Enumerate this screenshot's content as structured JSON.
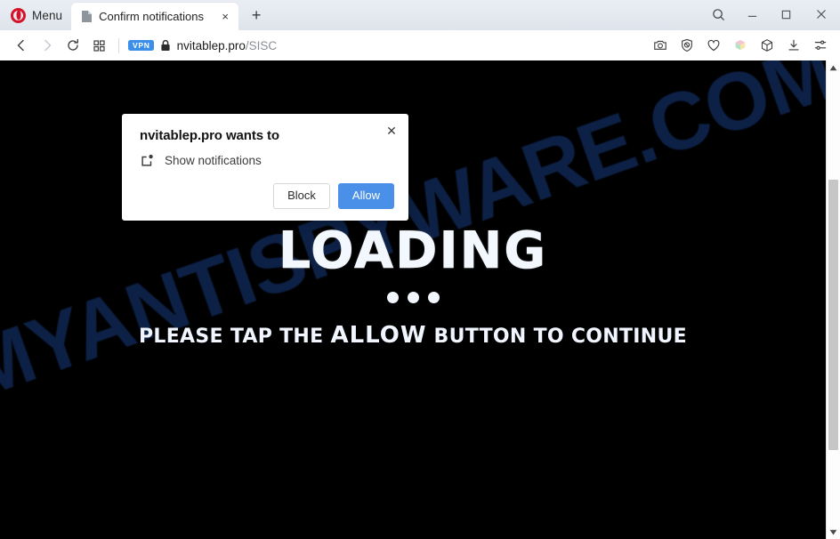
{
  "browser": {
    "menu_label": "Menu",
    "tab": {
      "title": "Confirm notifications",
      "favicon": "page-icon",
      "close": "×"
    },
    "new_tab": "+",
    "window_controls": {
      "search": "search-icon",
      "minimize": "minimize-icon",
      "maximize": "maximize-icon",
      "close": "close-icon"
    },
    "toolbar": {
      "back": "back-arrow-icon",
      "forward": "forward-arrow-icon",
      "reload": "reload-icon",
      "speed_dial": "grid-icon",
      "vpn_badge": "VPN",
      "lock": "padlock-icon",
      "url_domain": "nvitablep.pro",
      "url_path": "/SISC",
      "right_icons": [
        "snapshot-camera-icon",
        "ad-blocker-shield-icon",
        "heart-favorite-icon",
        "workspaces-cube-icon",
        "package-box-icon",
        "downloads-icon",
        "easy-setup-sliders-icon"
      ]
    },
    "accent_colors": {
      "opera_red": "#d6122a",
      "vpn_blue": "#3b8fe8",
      "allow_blue": "#4a90e8",
      "tabstrip_bg": "#e4e8ef"
    }
  },
  "dialog": {
    "title": "nvitablep.pro wants to",
    "permission_icon": "notification-bell-icon",
    "permission_text": "Show notifications",
    "block_label": "Block",
    "allow_label": "Allow",
    "close_glyph": "✕"
  },
  "page": {
    "background_color": "#000000",
    "watermark": {
      "text": "MYANTISPYWARE.COM",
      "color": "#0d2146"
    },
    "heading": "LOADING",
    "dots_count": 3,
    "subline_prefix": "PLEASE TAP THE",
    "subline_strong": "ALLOW",
    "subline_suffix": "BUTTON TO CONTINUE"
  }
}
